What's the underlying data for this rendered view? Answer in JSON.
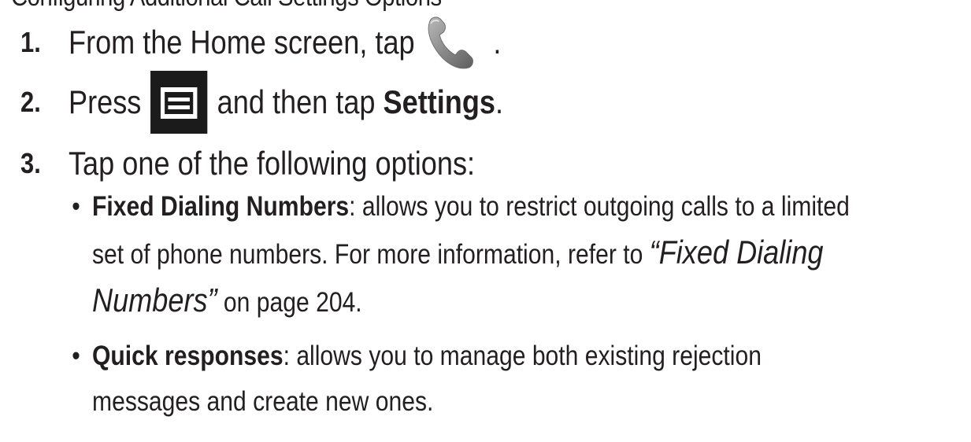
{
  "intro_fragment": "Configuring Additional Call Settings Options",
  "steps": [
    {
      "number": "1.",
      "text_before": "From the Home screen, tap",
      "icon": "phone-icon",
      "text_after": "."
    },
    {
      "number": "2.",
      "text_before": "Press",
      "icon": "menu-key-icon",
      "text_middle": "and then tap",
      "bold": "Settings",
      "text_after": "."
    },
    {
      "number": "3.",
      "text": "Tap one of the following options:"
    }
  ],
  "options": [
    {
      "bullet": "•",
      "label": "Fixed Dialing Numbers",
      "line1_rest": ": allows you to restrict outgoing calls to a limited",
      "line2_start": "set of phone numbers. For more information, refer to ",
      "ref_part1": "“Fixed Dialing",
      "ref_part2": "Numbers”",
      "line3_rest": " on page 204."
    },
    {
      "bullet": "•",
      "label": "Quick responses",
      "line1_rest": ": allows you to manage both existing rejection",
      "line2": "messages and create new ones."
    }
  ],
  "colors": {
    "text": "#231f20",
    "menu_key_bg": "#1b1b1b",
    "phone_icon_grey": "#8a8a8a"
  }
}
